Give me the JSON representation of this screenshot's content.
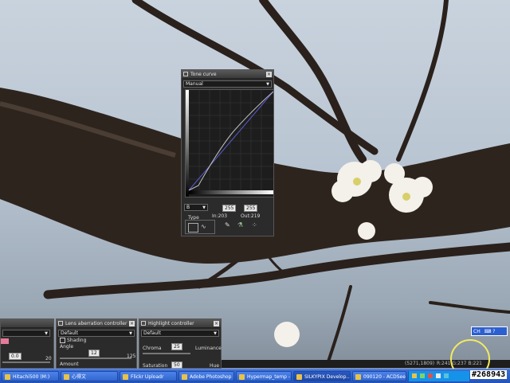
{
  "tone_curve": {
    "title": "Tone curve",
    "preset": "Manual",
    "channel": "B",
    "input_value": "255",
    "output_value": "255",
    "readout_in": "In:203",
    "readout_out": "Out:219",
    "type_label": "Type"
  },
  "left_panel": {
    "value": "0.0",
    "max": "20"
  },
  "lens_panel": {
    "title": "Lens aberration controller",
    "preset": "Default",
    "shading_label": "Shading",
    "angle_label": "Angle",
    "angle_value": "12",
    "angle_max": "125",
    "amount_label": "Amount"
  },
  "highlight_panel": {
    "title": "Highlight controller",
    "preset": "Default",
    "chroma_label": "Chroma",
    "chroma_value": "25",
    "luminance_label": "Luminance",
    "saturation_label": "Saturation",
    "saturation_value": "50",
    "hue_label": "Hue"
  },
  "status": {
    "coords": "(5271,1809)",
    "rgb": "R:241 G:237 B:221"
  },
  "language_bar": {
    "label": "CH"
  },
  "taskbar": {
    "items": [
      "Hitachi500 (M:)",
      "心得文",
      "Flickr Uploadr",
      "Adobe Photoshop",
      "Hypermap_temp -",
      "SILKYPIX Develop...",
      "090120 - ACDSee"
    ]
  },
  "watermark": "#268943",
  "colors": {
    "taskbar": "#2453b6",
    "panel": "#2b2b2b",
    "curve": "#5b5bd6",
    "highlight_circle": "#f3ea60"
  }
}
